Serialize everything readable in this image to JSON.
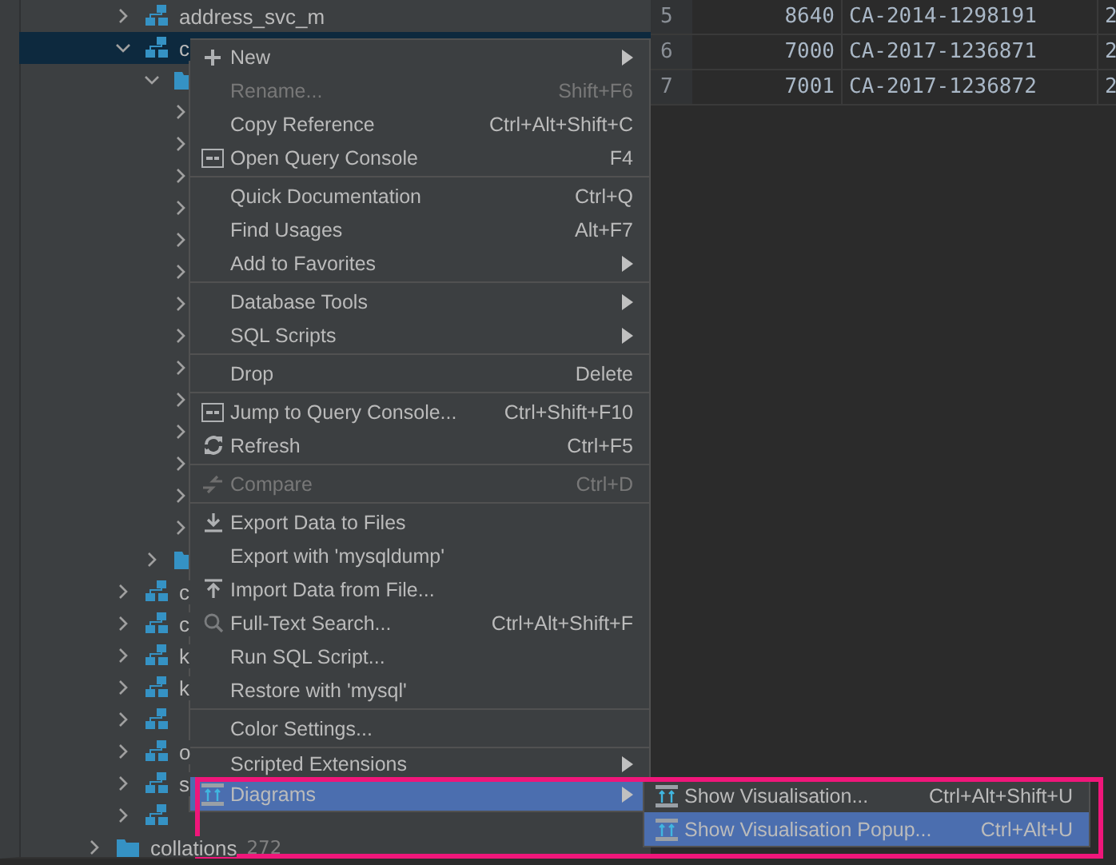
{
  "tree": {
    "schema_nodes": [
      {
        "label": "address_svc_m",
        "expanded": false,
        "selected": false
      },
      {
        "label": "c",
        "expanded": true,
        "selected": true,
        "children": [
          {
            "kind": "folder",
            "expanded": true,
            "children": [
              {
                "expanded": false
              },
              {
                "expanded": false
              },
              {
                "expanded": false
              },
              {
                "expanded": false
              },
              {
                "expanded": false
              },
              {
                "expanded": false
              },
              {
                "expanded": false
              },
              {
                "expanded": false
              },
              {
                "expanded": false
              },
              {
                "expanded": false
              },
              {
                "expanded": false
              },
              {
                "expanded": false
              },
              {
                "expanded": false
              },
              {
                "expanded": false
              }
            ]
          },
          {
            "kind": "folder",
            "expanded": false
          }
        ]
      },
      {
        "label": "c",
        "expanded": false,
        "selected": false
      },
      {
        "label": "c",
        "expanded": false,
        "selected": false
      },
      {
        "label": "k",
        "expanded": false,
        "selected": false
      },
      {
        "label": "k",
        "expanded": false,
        "selected": false
      },
      {
        "expanded": false,
        "selected": false
      },
      {
        "label": "o",
        "expanded": false,
        "selected": false
      },
      {
        "label": "s",
        "expanded": false,
        "selected": false
      },
      {
        "expanded": false,
        "selected": false
      }
    ],
    "next_nodes": [
      {
        "kind": "folder",
        "label": "collations",
        "count": "272",
        "expanded": false,
        "selected": false
      }
    ]
  },
  "grid": {
    "rows": [
      {
        "number": "5",
        "cells": [
          "8640",
          "CA-2014-1298191",
          "2"
        ]
      },
      {
        "number": "6",
        "cells": [
          "7000",
          "CA-2017-1236871",
          "2"
        ]
      },
      {
        "number": "7",
        "cells": [
          "7001",
          "CA-2017-1236872",
          "2"
        ]
      }
    ]
  },
  "context_menu": {
    "groups": [
      [
        {
          "label": "New",
          "kind": "plus",
          "submenu": true,
          "disabled": false,
          "selected": false
        },
        {
          "label": "Rename...",
          "shortcut": "Shift+F6",
          "submenu": false,
          "disabled": true,
          "selected": false
        },
        {
          "label": "Copy Reference",
          "shortcut": "Ctrl+Alt+Shift+C",
          "submenu": false,
          "disabled": false,
          "selected": false
        },
        {
          "label": "Open Query Console",
          "kind": "console",
          "shortcut": "F4",
          "submenu": false,
          "disabled": false,
          "selected": false
        }
      ],
      [
        {
          "label": "Quick Documentation",
          "shortcut": "Ctrl+Q",
          "submenu": false,
          "disabled": false,
          "selected": false
        },
        {
          "label": "Find Usages",
          "shortcut": "Alt+F7",
          "submenu": false,
          "disabled": false,
          "selected": false
        },
        {
          "label": "Add to Favorites",
          "submenu": true,
          "disabled": false,
          "selected": false
        }
      ],
      [
        {
          "label": "Database Tools",
          "submenu": true,
          "disabled": false,
          "selected": false
        },
        {
          "label": "SQL Scripts",
          "submenu": true,
          "disabled": false,
          "selected": false
        }
      ],
      [
        {
          "label": "Drop",
          "shortcut": "Delete",
          "submenu": false,
          "disabled": false,
          "selected": false
        }
      ],
      [
        {
          "label": "Jump to Query Console...",
          "kind": "console",
          "shortcut": "Ctrl+Shift+F10",
          "submenu": false,
          "disabled": false,
          "selected": false
        },
        {
          "label": "Refresh",
          "kind": "refresh",
          "shortcut": "Ctrl+F5",
          "submenu": false,
          "disabled": false,
          "selected": false
        }
      ],
      [
        {
          "label": "Compare",
          "kind": "compare",
          "shortcut": "Ctrl+D",
          "submenu": false,
          "disabled": true,
          "selected": false
        }
      ],
      [
        {
          "label": "Export Data to Files",
          "kind": "export",
          "submenu": false,
          "disabled": false,
          "selected": false
        },
        {
          "label": "Export with 'mysqldump'",
          "submenu": false,
          "disabled": false,
          "selected": false
        },
        {
          "label": "Import Data from File...",
          "kind": "import",
          "submenu": false,
          "disabled": false,
          "selected": false
        },
        {
          "label": "Full-Text Search...",
          "kind": "search",
          "shortcut": "Ctrl+Alt+Shift+F",
          "submenu": false,
          "disabled": false,
          "selected": false
        },
        {
          "label": "Run SQL Script...",
          "submenu": false,
          "disabled": false,
          "selected": false
        },
        {
          "label": "Restore with 'mysql'",
          "submenu": false,
          "disabled": false,
          "selected": false
        }
      ],
      [
        {
          "label": "Color Settings...",
          "submenu": false,
          "disabled": false,
          "selected": false
        }
      ],
      [
        {
          "label": "Scripted Extensions",
          "submenu": true,
          "disabled": false,
          "selected": false
        },
        {
          "label": "Diagrams",
          "kind": "diagram",
          "submenu": true,
          "disabled": false,
          "selected": true
        }
      ]
    ]
  },
  "submenu": {
    "items": [
      {
        "label": "Show Visualisation...",
        "kind": "diagram",
        "shortcut": "Ctrl+Alt+Shift+U",
        "selected": false
      },
      {
        "label": "Show Visualisation Popup...",
        "kind": "diagram",
        "shortcut": "Ctrl+Alt+U",
        "selected": true
      }
    ]
  },
  "highlight_frame": {
    "shown": true
  }
}
